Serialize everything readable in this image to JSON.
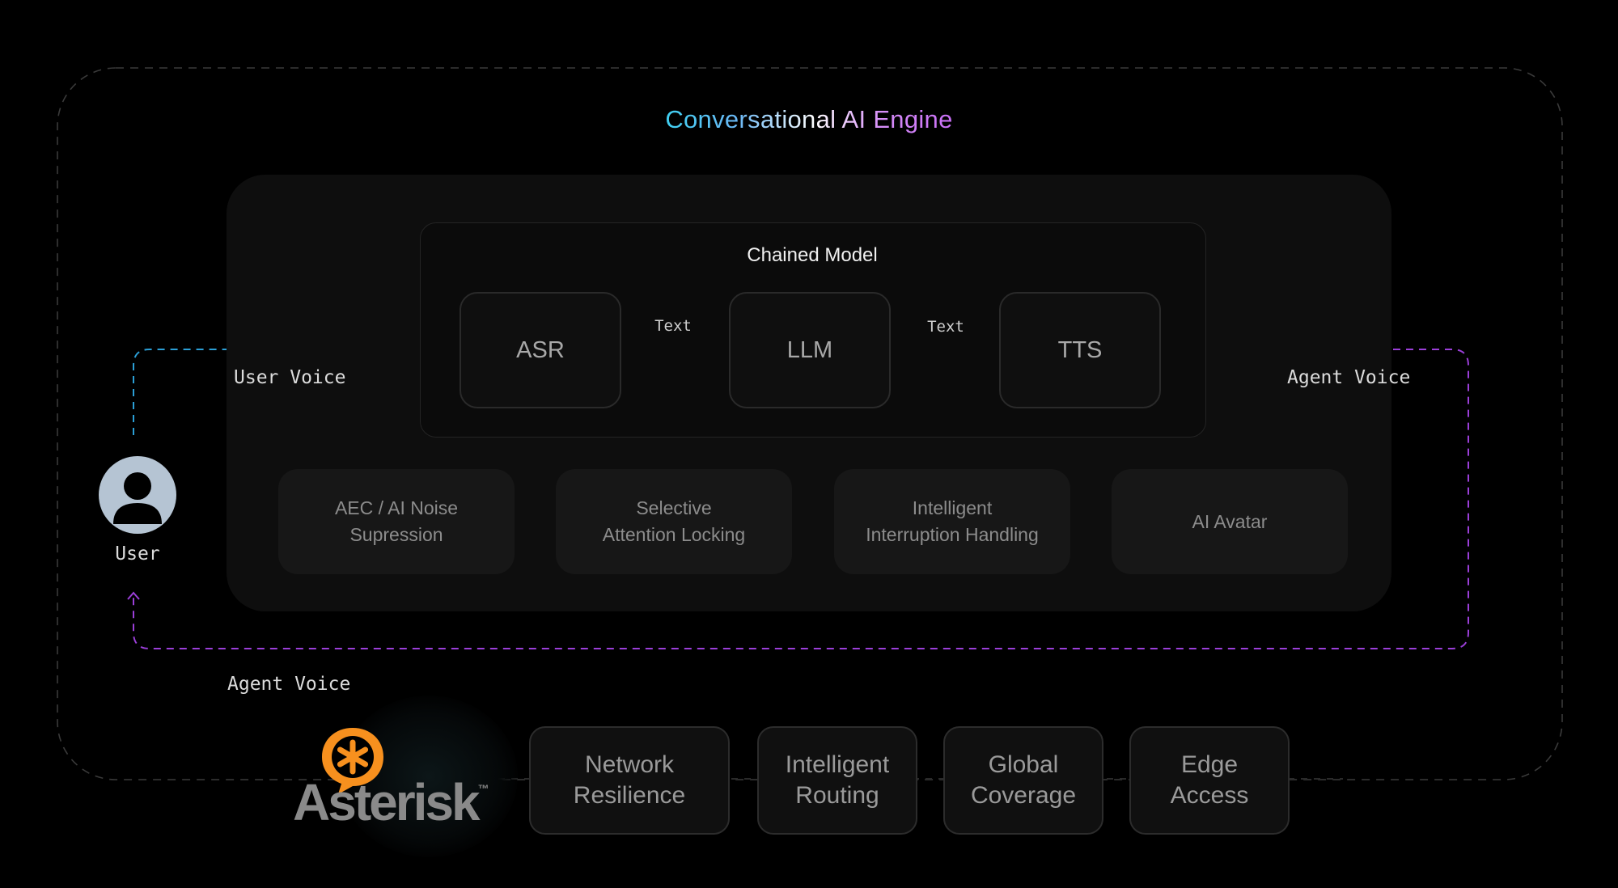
{
  "title": {
    "part1": "Conversational AI Engine",
    "gradient": [
      "#3fd0f2",
      "#ffffff",
      "#c86ef6"
    ]
  },
  "chained_model": {
    "title": "Chained Model",
    "stages": [
      {
        "id": "asr",
        "label": "ASR"
      },
      {
        "id": "llm",
        "label": "LLM"
      },
      {
        "id": "tts",
        "label": "TTS"
      }
    ],
    "links": [
      "Text",
      "Text"
    ]
  },
  "voice_flow": {
    "user_voice": "User Voice",
    "agent_voice_right": "Agent Voice",
    "agent_voice_bottom": "Agent Voice",
    "user_voice_color": "#2b9fd6",
    "agent_voice_color": "#9b3fd9"
  },
  "user": {
    "label": "User",
    "icon": "user-avatar-icon"
  },
  "features": [
    {
      "label": "AEC / AI Noise\nSupression"
    },
    {
      "label": "Selective\nAttention Locking"
    },
    {
      "label": "Intelligent\nInterruption Handling"
    },
    {
      "label": "AI Avatar"
    }
  ],
  "asterisk": {
    "logo_text": "Asterisk",
    "trademark": "™",
    "accent_color": "#f7901e"
  },
  "infrastructure": [
    {
      "label": "Network\nResilience"
    },
    {
      "label": "Intelligent\nRouting"
    },
    {
      "label": "Global\nCoverage"
    },
    {
      "label": "Edge\nAccess"
    }
  ]
}
